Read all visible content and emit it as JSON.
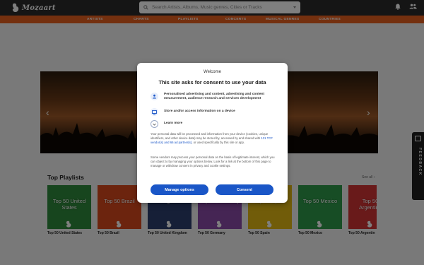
{
  "app": {
    "logo_text": "Mozaart"
  },
  "search": {
    "placeholder": "Search Artists, Albums, Music genres, Cities or Tracks"
  },
  "nav": [
    "ARTISTS",
    "CHARTS",
    "PLAYLISTS",
    "CONCERTS",
    "MUSICAL GENRES",
    "COUNTRIES"
  ],
  "playlists": {
    "title": "Top Playlists",
    "see_all": "See all ›",
    "items": [
      {
        "tile_text": "Top 50 United States",
        "label": "Top 50 United States",
        "color": "#2f8a3c"
      },
      {
        "tile_text": "Top 50 Brazil",
        "label": "Top 50 Brazil",
        "color": "#d9481c"
      },
      {
        "tile_text": "Kingdom",
        "label": "Top 50 United Kingdom",
        "color": "#2d3e6e"
      },
      {
        "tile_text": "Top 50 Germany",
        "label": "Top 50 Germany",
        "color": "#8a4aa8"
      },
      {
        "tile_text": "Top 50 Spain",
        "label": "Top 50 Spain",
        "color": "#e3b813"
      },
      {
        "tile_text": "Top 50 Mexico",
        "label": "Top 50 Mexico",
        "color": "#2e9a4a"
      },
      {
        "tile_text": "Top 50 Argentina",
        "label": "Top 50 Argentin",
        "color": "#d33434"
      }
    ]
  },
  "feedback": {
    "label": "FEEDBACK"
  },
  "consent": {
    "welcome": "Welcome",
    "title": "This site asks for consent to use your data",
    "purposes": [
      {
        "icon": "person-icon",
        "text": "Personalised advertising and content, advertising and content measurement, audience research and services development"
      },
      {
        "icon": "device-icon",
        "text": "Store and/or access information on a device"
      },
      {
        "icon": "chevron-down-icon",
        "text": "Learn more"
      }
    ],
    "para1_a": "Your personal data will be processed and information from your device (cookies, unique identifiers, and other device data) may be stored by, accessed by and shared with ",
    "para1_link": "131 TCF vendor(s) and 66 ad partner(s)",
    "para1_b": ", or used specifically by this site or app.",
    "para2": "Some vendors may process your personal data on the basis of legitimate interest, which you can object to by managing your options below. Look for a link at the bottom of this page to manage or withdraw consent in privacy and cookie settings.",
    "manage_label": "Manage options",
    "consent_label": "Consent",
    "accent": "#1a56c7"
  }
}
